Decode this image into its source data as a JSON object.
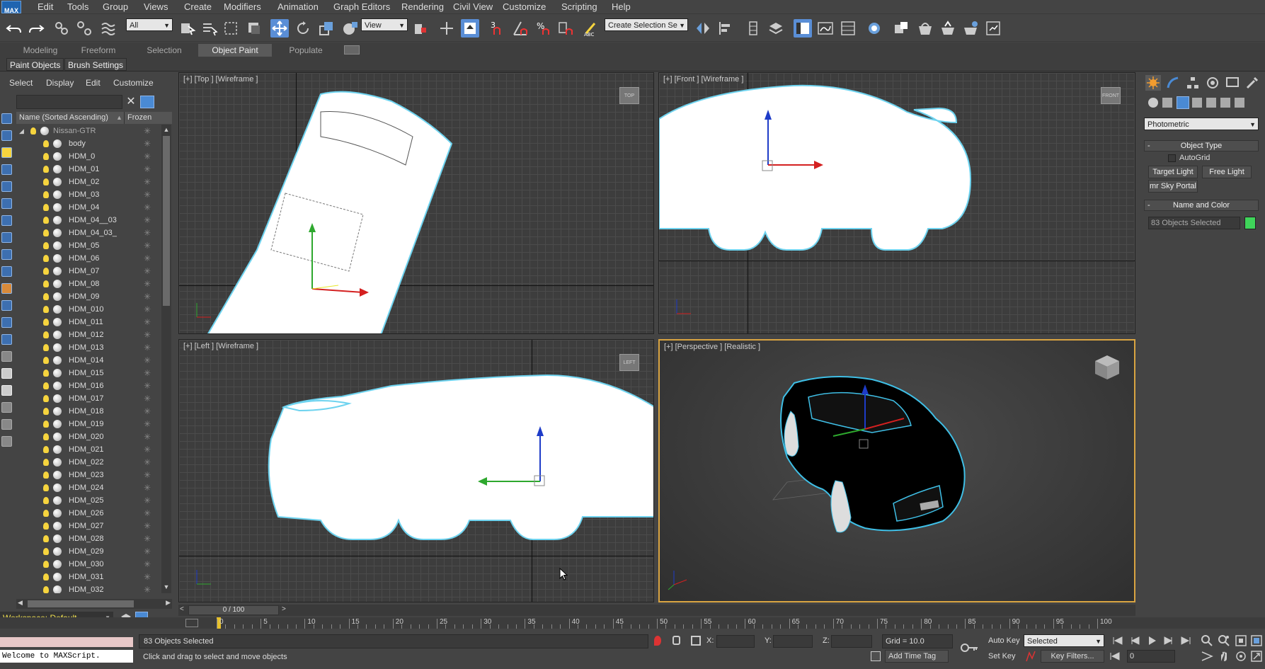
{
  "app": {
    "logo": "MAX"
  },
  "menu": [
    "Edit",
    "Tools",
    "Group",
    "Views",
    "Create",
    "Modifiers",
    "Animation",
    "Graph Editors",
    "Rendering",
    "Civil View",
    "Customize",
    "Scripting",
    "Help"
  ],
  "toolbar": {
    "filter": "All",
    "ref_coord": "View",
    "selection_set": "Create Selection Se"
  },
  "ribbon": {
    "tabs": [
      "Modeling",
      "Freeform",
      "Selection",
      "Object Paint",
      "Populate"
    ],
    "active_tab": "Object Paint",
    "buttons": [
      "Paint Objects",
      "Brush Settings"
    ]
  },
  "explorer": {
    "menus": [
      "Select",
      "Display",
      "Edit",
      "Customize"
    ],
    "col_name": "Name (Sorted Ascending)",
    "col_frozen": "Frozen",
    "root": "Nissan-GTR",
    "items": [
      "body",
      "HDM_0",
      "HDM_01",
      "HDM_02",
      "HDM_03",
      "HDM_04",
      "HDM_04__03",
      "HDM_04_03_",
      "HDM_05",
      "HDM_06",
      "HDM_07",
      "HDM_08",
      "HDM_09",
      "HDM_010",
      "HDM_011",
      "HDM_012",
      "HDM_013",
      "HDM_014",
      "HDM_015",
      "HDM_016",
      "HDM_017",
      "HDM_018",
      "HDM_019",
      "HDM_020",
      "HDM_021",
      "HDM_022",
      "HDM_023",
      "HDM_024",
      "HDM_025",
      "HDM_026",
      "HDM_027",
      "HDM_028",
      "HDM_029",
      "HDM_030",
      "HDM_031",
      "HDM_032"
    ]
  },
  "workspace": "Workspace: Default",
  "viewports": {
    "top": "[+] [Top ] [Wireframe ]",
    "front": "[+] [Front ] [Wireframe ]",
    "left": "[+] [Left ] [Wireframe ]",
    "persp": "[+] [Perspective ] [Realistic ]",
    "cube_top": "TOP",
    "cube_front": "FRONT",
    "cube_left": "LEFT"
  },
  "command_panel": {
    "dropdown": "Photometric",
    "object_type": "Object Type",
    "autogrid": "AutoGrid",
    "btn_target": "Target Light",
    "btn_free": "Free Light",
    "btn_sky": "mr Sky Portal",
    "name_color": "Name and Color",
    "name_value": "83 Objects Selected",
    "swatch_color": "#3fd45a"
  },
  "timeline": {
    "frame": "0 / 100",
    "ticks": [
      "0",
      "5",
      "10",
      "15",
      "20",
      "25",
      "30",
      "35",
      "40",
      "45",
      "50",
      "55",
      "60",
      "65",
      "70",
      "75",
      "80",
      "85",
      "90",
      "95",
      "100"
    ]
  },
  "status": {
    "maxscript": "Welcome to MAXScript.",
    "selected": "83 Objects Selected",
    "prompt": "Click and drag to select and move objects",
    "x_label": "X:",
    "y_label": "Y:",
    "z_label": "Z:",
    "grid": "Grid = 10.0",
    "auto_key": "Auto Key",
    "key_mode": "Selected",
    "set_key": "Set Key",
    "key_filters": "Key Filters...",
    "add_time_tag": "Add Time Tag",
    "frame_field": "0"
  }
}
